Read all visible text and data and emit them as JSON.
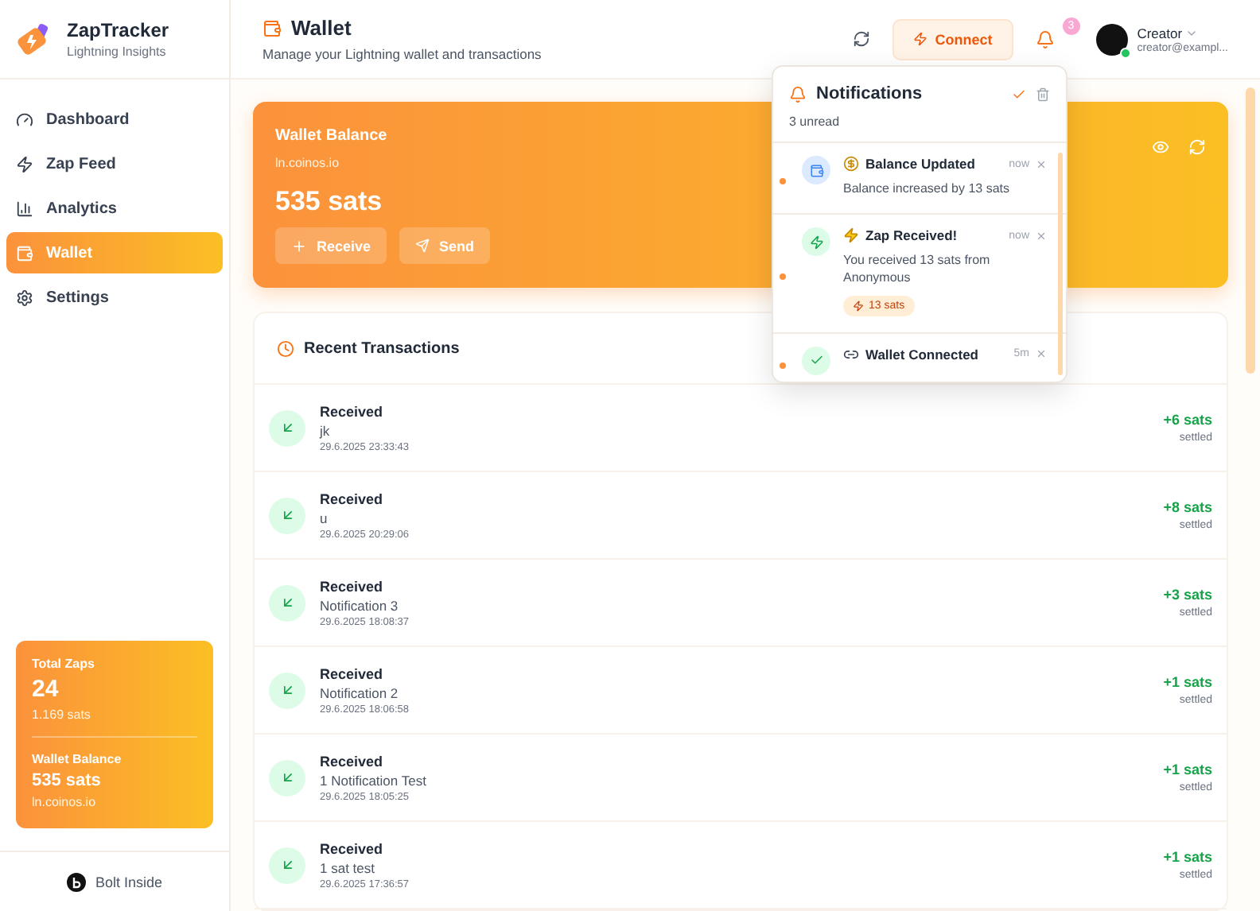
{
  "app": {
    "name": "ZapTracker",
    "tagline": "Lightning Insights"
  },
  "sidebar": {
    "items": [
      {
        "label": "Dashboard",
        "kind": "dashboard",
        "selected": false
      },
      {
        "label": "Zap Feed",
        "kind": "zap",
        "selected": false
      },
      {
        "label": "Analytics",
        "kind": "analytics",
        "selected": false
      },
      {
        "label": "Wallet",
        "kind": "wallet",
        "selected": true
      },
      {
        "label": "Settings",
        "kind": "settings",
        "selected": false
      }
    ],
    "stats": {
      "total_label": "Total Zaps",
      "total": "24",
      "total_sats": "1.169 sats",
      "wallet_label": "Wallet Balance",
      "wallet_sats": "535 sats",
      "wallet_host": "ln.coinos.io"
    },
    "footer": "Bolt Inside"
  },
  "header": {
    "title": "Wallet",
    "subtitle": "Manage your Lightning wallet and transactions",
    "connect": "Connect",
    "notification_count": "3",
    "user": {
      "name": "Creator",
      "email": "creator@exampl...",
      "online": true
    }
  },
  "wallet": {
    "title": "Wallet Balance",
    "host": "ln.coinos.io",
    "balance": "535 sats",
    "buttons": [
      {
        "label": "Receive",
        "kind": "receive"
      },
      {
        "label": "Send",
        "kind": "send"
      }
    ]
  },
  "transactions": {
    "title": "Recent Transactions",
    "rows": [
      {
        "type": "Received",
        "memo": "jk",
        "date": "29.6.2025 23:33:43",
        "amount": "+6 sats",
        "status": "settled"
      },
      {
        "type": "Received",
        "memo": "u",
        "date": "29.6.2025 20:29:06",
        "amount": "+8 sats",
        "status": "settled"
      },
      {
        "type": "Received",
        "memo": "Notification 3",
        "date": "29.6.2025 18:08:37",
        "amount": "+3 sats",
        "status": "settled"
      },
      {
        "type": "Received",
        "memo": "Notification 2",
        "date": "29.6.2025 18:06:58",
        "amount": "+1 sats",
        "status": "settled"
      },
      {
        "type": "Received",
        "memo": "1 Notification Test",
        "date": "29.6.2025 18:05:25",
        "amount": "+1 sats",
        "status": "settled"
      },
      {
        "type": "Received",
        "memo": "1 sat test",
        "date": "29.6.2025 17:36:57",
        "amount": "+1 sats",
        "status": "settled"
      }
    ]
  },
  "notifications": {
    "title": "Notifications",
    "unread_label": "3 unread",
    "items": [
      {
        "kind": "balance",
        "title": "Balance Updated",
        "time": "now",
        "body": "Balance increased by 13 sats",
        "unread": true
      },
      {
        "kind": "zap",
        "title": "Zap Received!",
        "time": "now",
        "body": "You received 13 sats from Anonymous",
        "badge": "13 sats",
        "unread": true
      },
      {
        "kind": "connected",
        "title": "Wallet Connected",
        "time": "5m",
        "unread": true
      }
    ]
  }
}
